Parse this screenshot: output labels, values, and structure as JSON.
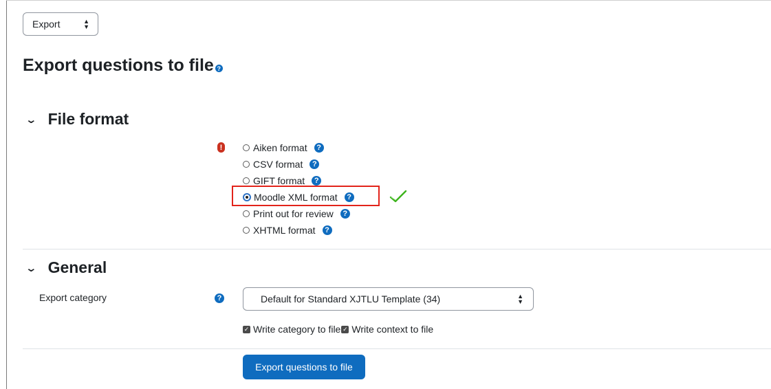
{
  "top_select": {
    "value": "Export"
  },
  "page": {
    "title": "Export questions to file"
  },
  "file_format": {
    "header": "File format",
    "options": [
      {
        "label": "Aiken format",
        "checked": false
      },
      {
        "label": "CSV format",
        "checked": false
      },
      {
        "label": "GIFT format",
        "checked": false
      },
      {
        "label": "Moodle XML format",
        "checked": true
      },
      {
        "label": "Print out for review",
        "checked": false
      },
      {
        "label": "XHTML format",
        "checked": false
      }
    ]
  },
  "general": {
    "header": "General",
    "export_category_label": "Export category",
    "export_category_value": "Default for Standard XJTLU Template (34)",
    "checkboxes": [
      {
        "label": "Write category to file",
        "checked": true
      },
      {
        "label": "Write context to file",
        "checked": true
      }
    ]
  },
  "submit": {
    "label": "Export questions to file"
  },
  "colors": {
    "primary": "#0f6cbf",
    "error": "#ca3120",
    "highlight": "#e2231a",
    "check": "#3cb31c"
  }
}
